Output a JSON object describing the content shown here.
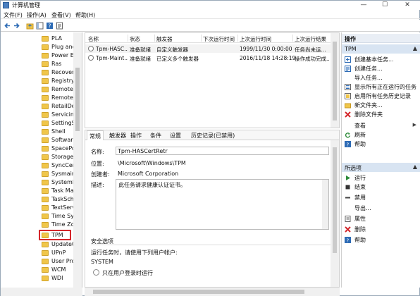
{
  "window": {
    "title": "计算机管理",
    "minimize": "—",
    "maximize": "☐",
    "close": "✕"
  },
  "menu": {
    "file": "文件(F)",
    "action": "操作(A)",
    "view": "查看(V)",
    "help": "帮助(H)"
  },
  "tree": {
    "items": [
      "PLA",
      "Plug and",
      "Power Ef",
      "Ras",
      "Recovery",
      "Registry",
      "RemoteA",
      "RemoteA",
      "RetailDer",
      "Servicing",
      "SettingSy",
      "Shell",
      "Software",
      "SpacePo",
      "Storage",
      "SyncCent",
      "Sysmain",
      "SystemR",
      "Task Ma",
      "TaskSche",
      "TextServi",
      "Time Syn",
      "Time Zo",
      "TPM",
      "UpdateC",
      "UPnP",
      "User Pro",
      "WCM",
      "WDI"
    ],
    "selected": "TPM"
  },
  "task_list": {
    "columns": [
      "名称",
      "状态",
      "触发器",
      "下次运行时间",
      "上次运行时间",
      "上次运行结果"
    ],
    "rows": [
      {
        "name": "Tpm-HASC...",
        "status": "准备就绪",
        "trigger": "自定义触发器",
        "next": "",
        "last": "1999/11/30 0:00:00",
        "result": "任务尚未运..."
      },
      {
        "name": "Tpm-Maint...",
        "status": "准备就绪",
        "trigger": "已定义多个触发器",
        "next": "",
        "last": "2016/11/18 14:28:19",
        "result": "操作成功完成..."
      }
    ]
  },
  "detail": {
    "tabs": [
      "常规",
      "触发器",
      "操作",
      "条件",
      "设置",
      "历史记录(已禁用)"
    ],
    "active_tab": "常规",
    "name_label": "名称:",
    "name_value": "Tpm-HASCertRetr",
    "location_label": "位置:",
    "location_value": "\\Microsoft\\Windows\\TPM",
    "author_label": "创建者:",
    "author_value": "Microsoft Corporation",
    "desc_label": "描述:",
    "desc_value": "此任务请求健康认证证书。",
    "security_title": "安全选项",
    "run_as_text": "运行任务时，请使用下列用户帐户:",
    "run_as_user": "SYSTEM",
    "radio_logged_on": "只在用户登录时运行"
  },
  "actions": {
    "header": "操作",
    "section1": "TPM",
    "items1": [
      {
        "label": "创建基本任务...",
        "icon": "create-basic-task-icon"
      },
      {
        "label": "创建任务...",
        "icon": "create-task-icon"
      },
      {
        "label": "导入任务...",
        "icon": "import-icon"
      },
      {
        "label": "显示所有正在运行的任务",
        "icon": "running-tasks-icon"
      },
      {
        "label": "启用所有任务历史记录",
        "icon": "history-icon"
      },
      {
        "label": "新文件夹...",
        "icon": "new-folder-icon"
      },
      {
        "label": "删除文件夹",
        "icon": "delete-icon"
      },
      {
        "label": "查看",
        "icon": "view-icon",
        "submenu": true
      },
      {
        "label": "刷新",
        "icon": "refresh-icon"
      },
      {
        "label": "帮助",
        "icon": "help-icon"
      }
    ],
    "section2": "所选项",
    "items2": [
      {
        "label": "运行",
        "icon": "run-icon"
      },
      {
        "label": "结束",
        "icon": "stop-icon"
      },
      {
        "label": "禁用",
        "icon": "disable-icon"
      },
      {
        "label": "导出...",
        "icon": "export-icon"
      },
      {
        "label": "属性",
        "icon": "properties-icon"
      },
      {
        "label": "删除",
        "icon": "delete-icon"
      },
      {
        "label": "帮助",
        "icon": "help-icon"
      }
    ]
  },
  "colors": {
    "accent": "#4a7fc0",
    "highlight_red": "#d4262b",
    "actions_header": "#e9eef5",
    "actions_sub": "#d8e4f2"
  }
}
